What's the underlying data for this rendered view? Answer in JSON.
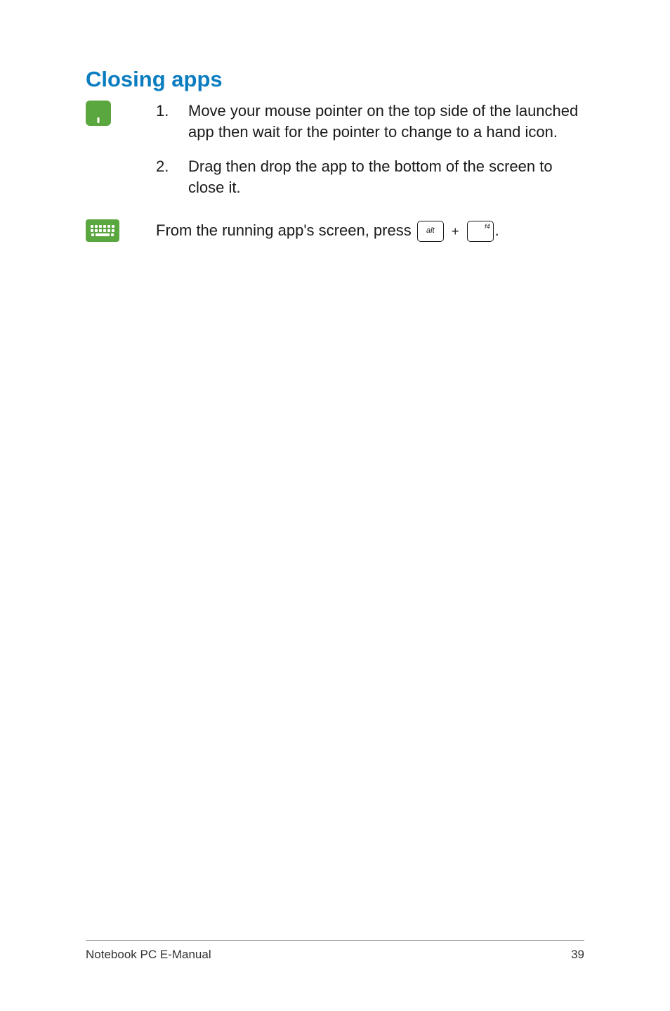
{
  "heading": "Closing apps",
  "touchpad_steps": [
    "Move your mouse pointer on the top side of the launched app then wait for the pointer to change to a hand icon.",
    "Drag then drop the app to the bottom of the screen to close it."
  ],
  "keyboard_instruction": {
    "prefix": "From the running app's screen, press ",
    "key1": "alt",
    "plus": "+",
    "key2": "f4",
    "suffix": "."
  },
  "footer": {
    "left": "Notebook PC E-Manual",
    "right": "39"
  }
}
